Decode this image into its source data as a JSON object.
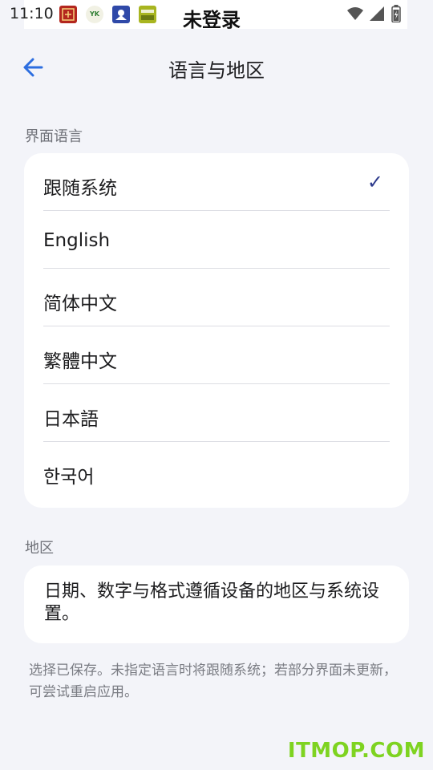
{
  "statusbar": {
    "time": "11:10",
    "overlay_title": "未登录",
    "notifications": [
      {
        "icon": "app-notification-red-icon",
        "color": "#b3261e"
      },
      {
        "icon": "app-notification-yk-icon",
        "label": "YK",
        "color": "#2e7d32"
      },
      {
        "icon": "app-notification-blue-icon",
        "color": "#2f49a8"
      },
      {
        "icon": "app-notification-green-icon",
        "color": "#a8b520"
      }
    ],
    "system_icons": [
      "wifi-icon",
      "signal-icon",
      "battery-icon"
    ]
  },
  "appbar": {
    "back_icon": "arrow-left-icon",
    "title": "语言与地区",
    "accent_color": "#2d6ee0"
  },
  "interface_language": {
    "section_label": "界面语言",
    "selected_index": 0,
    "items": [
      {
        "label": "跟随系统",
        "selected": true,
        "check": "✓"
      },
      {
        "label": "English",
        "selected": false
      },
      {
        "label": "简体中文",
        "selected": false
      },
      {
        "label": "繁體中文",
        "selected": false
      },
      {
        "label": "日本語",
        "selected": false
      },
      {
        "label": "한국어",
        "selected": false
      }
    ]
  },
  "region": {
    "section_label": "地区",
    "description": "日期、数字与格式遵循设备的地区与系统设置。"
  },
  "footnote": "选择已保存。未指定语言时将跟随系统；若部分界面未更新，可尝试重启应用。",
  "watermark": "ITMOP.COM"
}
